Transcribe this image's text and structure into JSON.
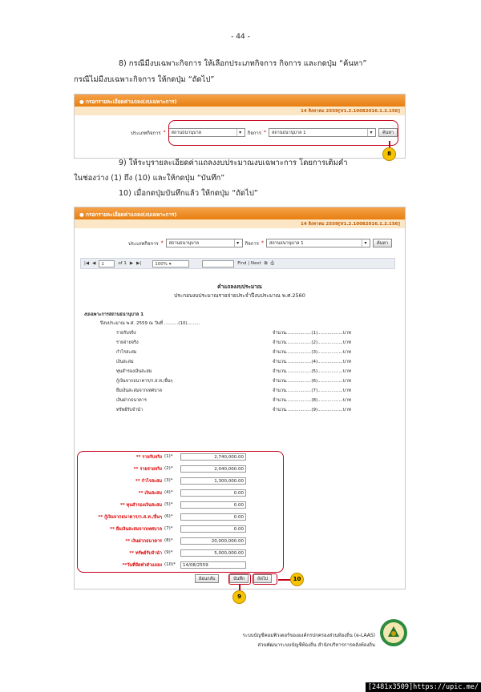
{
  "page_number": "- 44 -",
  "step8_line1": "8)  กรณีมีงบเฉพาะกิจการ ให้เลือกประเภทกิจการ กิจการ และกดปุ่ม “ค้นหา”",
  "step8_line2": "กรณีไม่มีงบเฉพาะกิจการ ให้กดปุ่ม “ถัดไป”",
  "panel_title": "กรอกรายละเอียดค่าแถลง(งบเฉพาะการ)",
  "panel_date": "14 สิงหาคม 2559[V1.2.10082016.1.2.156]",
  "form": {
    "type_label": "ประเภทกิจการ",
    "type_value": "สถานธนานุบาล",
    "business_label": "กิจการ",
    "business_value_1": "สถานธนานุบาล 1",
    "business_value_2": "สถานธนานุบาล 1",
    "search_label": "ค้นหา"
  },
  "step9_line1": "9)  ให้ระบุรายละเอียดค่าแถลงงบประมาณงบเฉพาะการ โดยการเติมคำ",
  "step9_line2": "ในช่องว่าง (1) ถึง (10) และให้กดปุ่ม “บันทึก”",
  "step10_line": "10)  เมื่อกดปุ่มบันทึกแล้ว ให้กดปุ่ม “ถัดไป”",
  "markers": {
    "m8": "8",
    "m9": "9",
    "m10": "10"
  },
  "toolbar": {
    "page_value": "1",
    "page_of": "of 1",
    "zoom": "100%",
    "find_label": "Find | Next"
  },
  "report": {
    "title": "คำแถลงงบประมาณ",
    "subtitle": "ประกอบงบประมาณรายจ่ายประจำปีงบประมาณ พ.ศ.2560",
    "section": "งบเฉพาะการสถานธนานุบาล 1",
    "date_line": "ปีงบประมาณ พ.ศ. 2559 ณ วันที่ ..........(10).........",
    "lines": [
      {
        "label": "รายรับจริง",
        "value": "จำนวน..................(1)..................บาท"
      },
      {
        "label": "รายจ่ายจริง",
        "value": "จำนวน..................(2)..................บาท"
      },
      {
        "label": "กำไรสะสม",
        "value": "จำนวน..................(3)..................บาท"
      },
      {
        "label": "เงินสะสม",
        "value": "จำนวน..................(4)..................บาท"
      },
      {
        "label": "ทุนสำรองเงินสะสม",
        "value": "จำนวน..................(5)..................บาท"
      },
      {
        "label": "กู้เงินจากธนาคาร/ก.ส.ท./อื่นๆ",
        "value": "จำนวน..................(6)..................บาท"
      },
      {
        "label": "ยืมเงินสะสมจากเทศบาล",
        "value": "จำนวน..................(7)..................บาท"
      },
      {
        "label": "เงินฝากธนาคาร",
        "value": "จำนวน..................(8)..................บาท"
      },
      {
        "label": "ทรัพย์รับจำนำ",
        "value": "จำนวน..................(9)..................บาท"
      }
    ]
  },
  "fields": [
    {
      "label": "** รายรับจริง",
      "num": "(1)*",
      "value": "2,740,000.00"
    },
    {
      "label": "** รายจ่ายจริง",
      "num": "(2)*",
      "value": "2,040,000.00"
    },
    {
      "label": "** กำไรสะสม",
      "num": "(3)*",
      "value": "1,300,000.00"
    },
    {
      "label": "** เงินสะสม",
      "num": "(4)*",
      "value": "0.00"
    },
    {
      "label": "** ทุนสำรองเงินสะสม",
      "num": "(5)*",
      "value": "0.00"
    },
    {
      "label": "** กู้เงินจากธนาคาร/ก.ส.ท./อื่นๆ",
      "num": "(6)*",
      "value": "0.00"
    },
    {
      "label": "** ยืมเงินสะสมจากเทศบาล",
      "num": "(7)*",
      "value": "0.00"
    },
    {
      "label": "** เงินฝากธนาคาร",
      "num": "(8)*",
      "value": "20,000,000.00"
    },
    {
      "label": "** ทรัพย์รับจำนำ",
      "num": "(9)*",
      "value": "5,000,000.00"
    },
    {
      "label": "**วันที่จัดทำคำแถลง",
      "num": "(10)*",
      "value": "14/08/2559"
    }
  ],
  "buttons": {
    "back": "ย้อนกลับ",
    "save": "บันทึก",
    "next": "ถัดไป"
  },
  "footer": {
    "line1": "ระบบบัญชีคอมพิวเตอร์ขององค์กรปกครองส่วนท้องถิ่น (e-LAAS)",
    "line2": "ส่วนพัฒนาระบบบัญชีท้องถิ่น  สำนักบริหารการคลังท้องถิ่น"
  },
  "url_bar": "[2481x3509]https://upic.me/"
}
